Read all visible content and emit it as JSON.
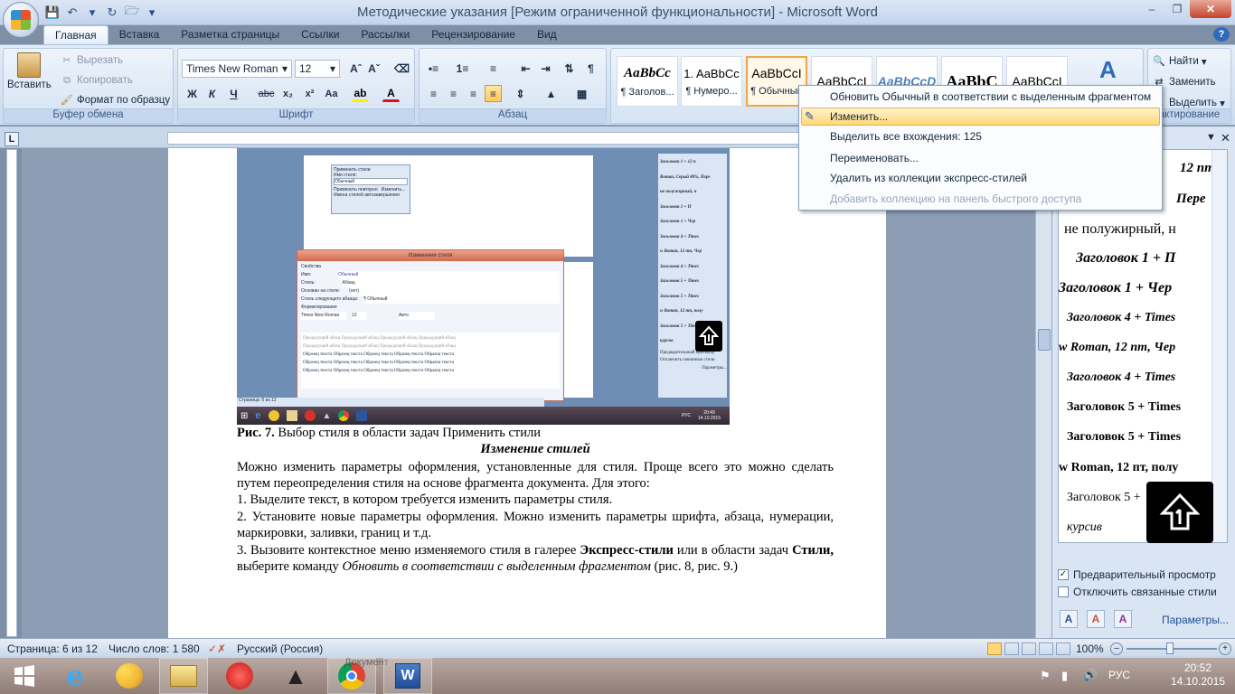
{
  "window": {
    "title": "Методические указания [Режим ограниченной функциональности]  -  Microsoft Word"
  },
  "tabs": [
    "Главная",
    "Вставка",
    "Разметка страницы",
    "Ссылки",
    "Рассылки",
    "Рецензирование",
    "Вид"
  ],
  "clipboard": {
    "paste": "Вставить",
    "cut": "Вырезать",
    "copy": "Копировать",
    "format_painter": "Формат по образцу",
    "label": "Буфер обмена"
  },
  "font": {
    "name": "Times New Roman",
    "size": "12",
    "label": "Шрифт"
  },
  "paragraph": {
    "label": "Абзац"
  },
  "styles_gallery": [
    {
      "sample": "AaBbCc",
      "name": ""
    },
    {
      "sample": "1. AaBbCc",
      "name": "¶ Заголов..."
    },
    {
      "sample": "AaBbCcI",
      "name": "¶ Нумеро..."
    },
    {
      "sample": "AaBbCcI",
      "name": "¶ Обычный"
    },
    {
      "sample": "AaBbCcD",
      "name": ""
    },
    {
      "sample": "AaBbC",
      "name": ""
    },
    {
      "sample": "AaBbCcI",
      "name": ""
    }
  ],
  "editing": {
    "find": "Найти",
    "replace": "Заменить",
    "select": "Выделить",
    "label": "актирование"
  },
  "context_menu": {
    "items": [
      "Обновить Обычный в соответствии с выделенным фрагментом",
      "Изменить...",
      "Выделить все вхождения: 125",
      "Переименовать...",
      "Удалить из коллекции экспресс-стилей",
      "Добавить коллекцию на панель быстрого доступа"
    ]
  },
  "document": {
    "caption_bold": "Рис. 7.",
    "caption_rest": " Выбор стиля в области задач Применить стили",
    "heading": "Изменение стилей",
    "para1": "Можно изменить параметры оформления, установленные для стиля. Проще всего это можно сделать путем переопределения стиля на основе фрагмента документа. Для этого:",
    "step1": "1.  Выделите текст, в котором требуется изменить параметры стиля.",
    "step2": "2.  Установите новые параметры оформления. Можно изменить параметры шрифта, абзаца, нумерации, маркировки, заливки, границ и т.д.",
    "step3_a": "3.  Вызовите контекстное меню изменяемого стиля в галерее ",
    "step3_b": "Экспресс-стили",
    "step3_c": " или в области задач ",
    "step3_d": "Стили,",
    "step3_e": " выберите команду ",
    "step3_f": "Обновить в соответствии с выделенным фрагментом",
    "step3_g": " (рис. 8, рис. 9.)"
  },
  "embedded_screenshot": {
    "dialog_title": "Изменение стиля",
    "apply_styles": "Применить стили",
    "style_name_label": "Имя стиля:",
    "style_name_value": "Обычный",
    "reapply": "Применить повторно",
    "change": "Изменить...",
    "autocomplete": "Имена стилей автозавершения",
    "props": "Свойства",
    "name_lbl": "Имя:",
    "name_val": "Обычный",
    "style_lbl": "Стиль:",
    "style_val": "Абзац",
    "based_lbl": "Основан на стиле:",
    "based_val": "(нет)",
    "next_lbl": "Стиль следующего абзаца:",
    "next_val": "¶ Обычный",
    "format": "Форматирование",
    "font_val": "Times New Roman",
    "size_val": "12",
    "auto_val": "Авто",
    "sample_prev": "Предыдущий абзац Предыдущий абзац Предыдущий абзац Предыдущий абзац",
    "sample_text": "Образец текста Образец текста Образец текста Образец текста Образец текста",
    "page_status": "Страница: 6 из 12",
    "preview": "Предварительный просмотр",
    "disable_linked": "Отключить связанные стили",
    "params": "Параметры...",
    "styles_title": "Стили",
    "items": [
      "Заголовок 1 + 12 п",
      "Roman, Серый 80%, Пере",
      "не полужирный, н",
      "Заголовок 1 + П",
      "Заголовок 1 + Чер",
      "Заголовок 4 + Times",
      "w Roman, 12 пт, Чер",
      "Заголовок 4 + Times",
      "Заголовок 5 + Times",
      "Заголовок 5 + Times",
      "w Roman, 12 пт, полу",
      "Заголовок 5 + Times",
      "курсив"
    ],
    "clock": "20:49",
    "date": "14.10.2015",
    "lang": "РУС"
  },
  "styles_pane": {
    "items": [
      "12 пт",
      "Пере",
      "не полужирный, н",
      "Заголовок 1 + П",
      "Заголовок 1 + Чер",
      "Заголовок 4 + Times",
      "w Roman, 12 пт, Чер",
      "Заголовок 4 + Times",
      "Заголовок 5 + Times",
      "Заголовок 5 + Times",
      "w Roman, 12 пт, полу",
      "Заголовок 5 +",
      "курсив"
    ],
    "preview_label": "Предварительный просмотр",
    "linked_label": "Отключить связанные стили",
    "params": "Параметры..."
  },
  "status": {
    "page": "Страница: 6 из 12",
    "words": "Число слов: 1 580",
    "language": "Русский (Россия)",
    "zoom": "100%"
  },
  "taskbar": {
    "time": "20:52",
    "date": "14.10.2015",
    "lang": "РУС",
    "doc_label": "Документ"
  },
  "colors": {
    "accent": "#ffd776",
    "ribbon": "#cadbee",
    "close": "#c4452c"
  }
}
